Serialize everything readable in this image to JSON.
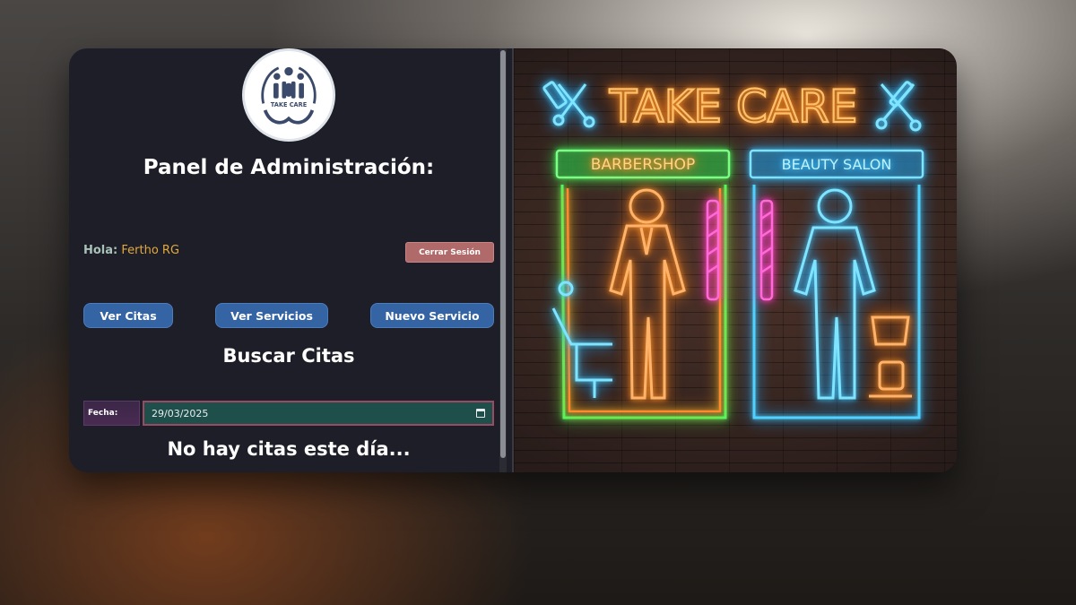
{
  "panel": {
    "logo_text": "TAKE CARE",
    "title": "Panel de Administración:",
    "greeting_label": "Hola:",
    "user_name": "Fertho RG",
    "logout_label": "Cerrar Sesión",
    "nav": [
      "Ver Citas",
      "Ver Servicios",
      "Nuevo Servicio"
    ],
    "search_title": "Buscar Citas",
    "date_label": "Fecha:",
    "date_value": "29/03/2025",
    "empty_message": "No hay citas este día..."
  },
  "hero": {
    "sign_text": "TAKE CARE",
    "left_sign": "BARBERSHOP",
    "right_sign": "BEAUTY SALON"
  },
  "colors": {
    "panel_bg": "#1d1e27",
    "button_blue": "#3464a3",
    "logout_red": "#b06a6a",
    "user_name": "#e4a93e",
    "neon_orange": "#ff9a2e",
    "neon_blue": "#4fd2ff",
    "neon_green": "#5aff6a"
  }
}
